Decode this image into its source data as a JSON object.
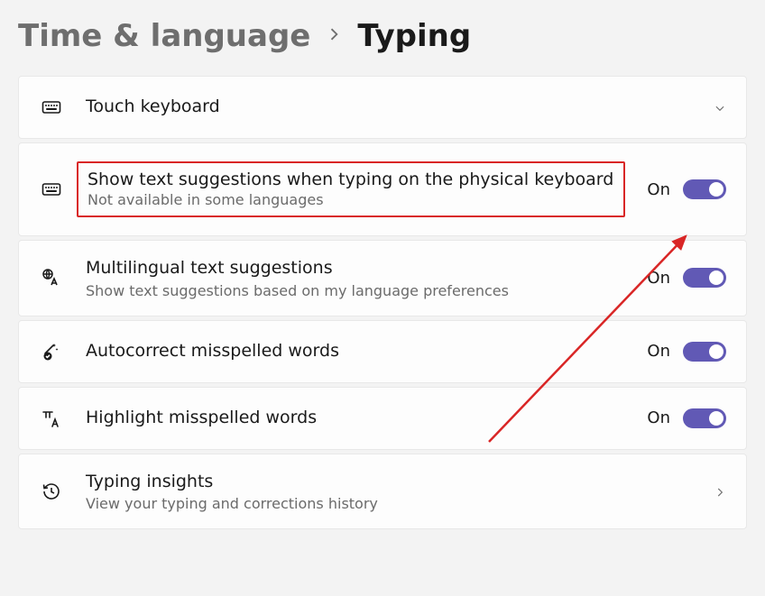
{
  "breadcrumb": {
    "parent": "Time & language",
    "current": "Typing"
  },
  "colors": {
    "accent": "#6159b5",
    "highlight": "#d92626"
  },
  "rows": {
    "touchKeyboard": {
      "title": "Touch keyboard"
    },
    "textSuggestions": {
      "title": "Show text suggestions when typing on the physical keyboard",
      "subtitle": "Not available in some languages",
      "toggleLabel": "On",
      "toggleOn": true
    },
    "multilingual": {
      "title": "Multilingual text suggestions",
      "subtitle": "Show text suggestions based on my language preferences",
      "toggleLabel": "On",
      "toggleOn": true
    },
    "autocorrect": {
      "title": "Autocorrect misspelled words",
      "toggleLabel": "On",
      "toggleOn": true
    },
    "highlight": {
      "title": "Highlight misspelled words",
      "toggleLabel": "On",
      "toggleOn": true
    },
    "insights": {
      "title": "Typing insights",
      "subtitle": "View your typing and corrections history"
    }
  }
}
